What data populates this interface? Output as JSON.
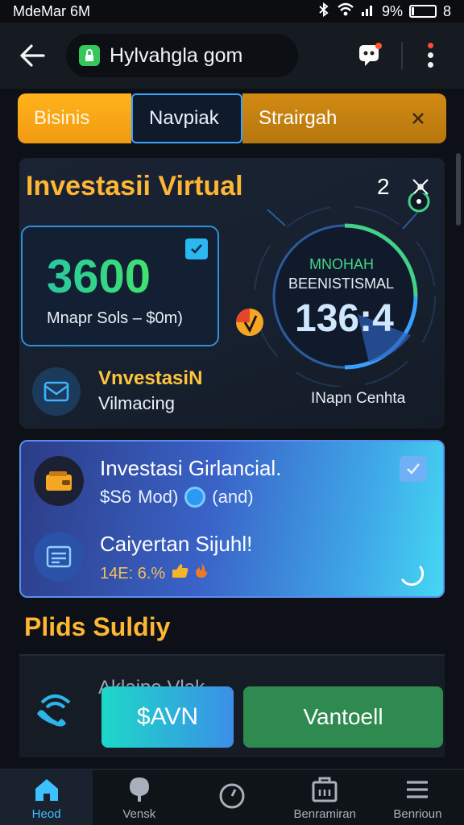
{
  "status_bar": {
    "carrier": "MdeMar 6M",
    "battery_pct": "9%",
    "battery_level": 0.09,
    "extra": "8"
  },
  "app_bar": {
    "url": "Hylvahgla gom"
  },
  "tabs": [
    {
      "label": "Bisinis"
    },
    {
      "label": "Navpiak"
    },
    {
      "label": "Strairgah"
    }
  ],
  "card1": {
    "title": "Investasii Virtual",
    "count": "2",
    "value_big": "3600",
    "value_sub": "Mnapr Sols – $0m)",
    "gauge_label1": "MNOHAH",
    "gauge_label2": "BEENISTISMAL",
    "gauge_value": "136:4",
    "gauge_caption": "INapn Cenhta",
    "invest_title": "VnvestasiN",
    "invest_sub": "Vilmacing"
  },
  "card2": {
    "row1_title": "Investasi Girlancial.",
    "row1_amount": "$S6",
    "row1_mod": "Mod)",
    "row1_tail": "(and)",
    "row2_title": "Caiyertan Sijuhl!",
    "row2_sub": "14E: 6.%"
  },
  "section": {
    "title": "Plids Suldiy",
    "list_text": "Aklaipe Vlak"
  },
  "buttons": {
    "save": "$AVN",
    "vault": "Vantoell"
  },
  "bottom_nav": [
    {
      "label": "Heod"
    },
    {
      "label": "Vensk"
    },
    {
      "label": ""
    },
    {
      "label": "Benramiran"
    },
    {
      "label": "Benrioun"
    }
  ],
  "colors": {
    "accent_orange": "#ffb31c",
    "accent_blue": "#3aa3ff",
    "accent_green": "#40e36d",
    "background": "#0d1117"
  }
}
